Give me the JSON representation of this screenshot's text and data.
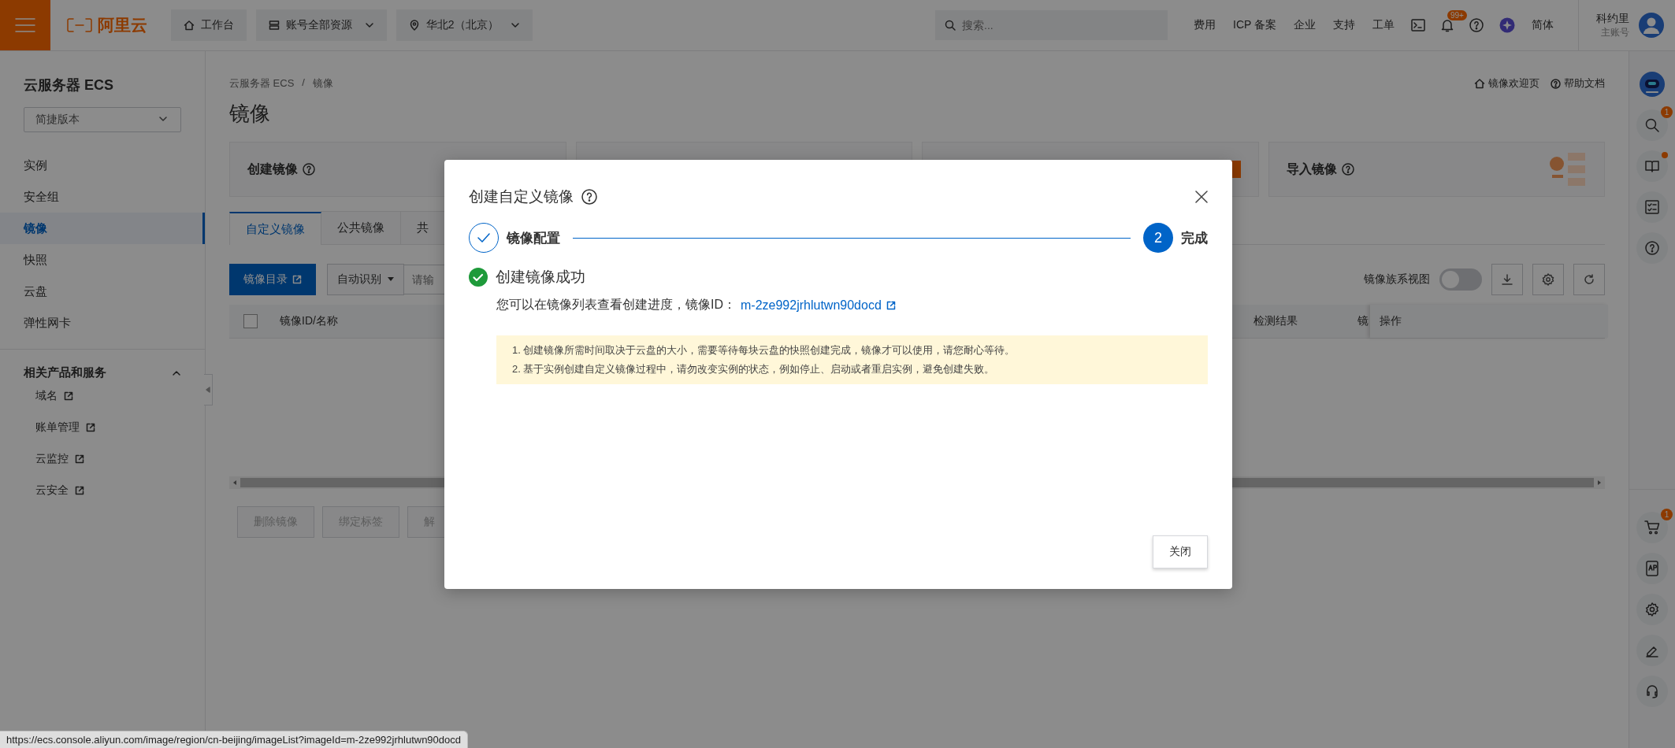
{
  "top_bar": {
    "logo": "阿里云",
    "workbench": "工作台",
    "resources": "账号全部资源",
    "region": "华北2（北京）",
    "search": {
      "placeholder": "搜索..."
    },
    "links": [
      "费用",
      "ICP 备案",
      "企业",
      "支持",
      "工单"
    ],
    "notification_badge": "99+",
    "language": "简体",
    "user": {
      "name": "科约里",
      "role": "主账号"
    }
  },
  "sidebar": {
    "title": "云服务器 ECS",
    "version_select": "简捷版本",
    "items": [
      {
        "label": "实例",
        "selected": false
      },
      {
        "label": "安全组",
        "selected": false
      },
      {
        "label": "镜像",
        "selected": true
      },
      {
        "label": "快照",
        "selected": false
      },
      {
        "label": "云盘",
        "selected": false
      },
      {
        "label": "弹性网卡",
        "selected": false
      }
    ],
    "section": {
      "title": "相关产品和服务",
      "expanded": true,
      "links": [
        "域名",
        "账单管理",
        "云监控",
        "云安全"
      ]
    }
  },
  "main": {
    "breadcrumb": [
      "云服务器 ECS",
      "镜像"
    ],
    "breadcrumb_separator": "/",
    "header_links": [
      "镜像欢迎页",
      "帮助文档"
    ],
    "title": "镜像",
    "cards": [
      {
        "title": "创建镜像"
      },
      {
        "title": "导入镜像"
      }
    ],
    "tabs": [
      {
        "label": "自定义镜像",
        "selected": true
      },
      {
        "label": "公共镜像",
        "selected": false
      },
      {
        "label": "共",
        "selected": false
      }
    ],
    "toolbar": {
      "catalog_button": "镜像目录",
      "filter": "自动识别",
      "search": {
        "placeholder": "请输"
      },
      "family_view": {
        "label": "镜像族系视图",
        "on": false
      }
    },
    "table": {
      "select_all_checked": false,
      "columns": [
        "镜像ID/名称",
        "检测结果",
        "镜",
        "操作"
      ]
    },
    "bulk_actions": [
      "删除镜像",
      "绑定标签",
      "解"
    ]
  },
  "dialog": {
    "title": "创建自定义镜像",
    "steps": [
      {
        "label": "镜像配置",
        "kind": "done"
      },
      {
        "label": "完成",
        "kind": "current",
        "number": "2"
      }
    ],
    "result": {
      "title": "创建镜像成功",
      "message": "您可以在镜像列表查看创建进度，镜像ID：",
      "image_id": "m-2ze992jrhlutwn90docd"
    },
    "notices": [
      "1. 创建镜像所需时间取决于云盘的大小，需要等待每块云盘的快照创建完成，镜像才可以使用，请您耐心等待。",
      "2. 基于实例创建自定义镜像过程中，请勿改变实例的状态，例如停止、启动或者重启实例，避免创建失败。"
    ],
    "close_button": "关闭"
  },
  "right_rail": {
    "top": [
      {
        "kind": "assistant",
        "dot": false
      },
      {
        "kind": "search",
        "badge": "1",
        "dot": false
      },
      {
        "kind": "guide",
        "dot": true
      },
      {
        "kind": "tasks",
        "dot": false
      },
      {
        "kind": "help",
        "dot": false
      }
    ],
    "bottom": [
      {
        "kind": "cart",
        "badge": "1",
        "dot": false
      },
      {
        "kind": "app",
        "dot": false
      },
      {
        "kind": "settings",
        "dot": false
      },
      {
        "kind": "edit",
        "dot": false
      },
      {
        "kind": "support",
        "dot": false
      }
    ]
  },
  "status_bar": {
    "url": "https://ecs.console.aliyun.com/image/region/cn-beijing/imageList?imageId=m-2ze992jrhlutwn90docd"
  }
}
